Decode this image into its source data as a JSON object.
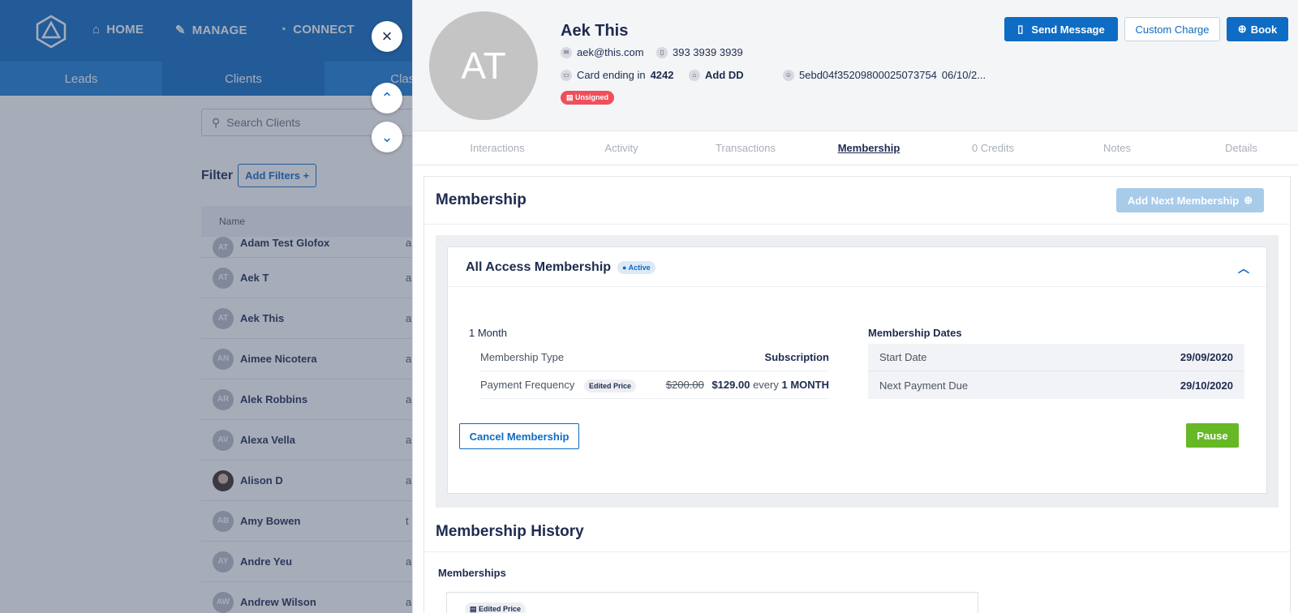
{
  "nav": {
    "home": "HOME",
    "manage": "MANAGE",
    "connect": "CONNECT",
    "subtabs": [
      "Leads",
      "Clients",
      "Class"
    ]
  },
  "client_list": {
    "search_placeholder": "Search Clients",
    "filter_label": "Filter",
    "add_filters": "Add Filters",
    "name_header": "Name",
    "rows": [
      {
        "initials": "AT",
        "name": "Adam Test Glofox",
        "trail": "a"
      },
      {
        "initials": "AT",
        "name": "Aek T",
        "trail": "a"
      },
      {
        "initials": "AT",
        "name": "Aek This",
        "trail": "a"
      },
      {
        "initials": "AN",
        "name": "Aimee Nicotera",
        "trail": "a"
      },
      {
        "initials": "AR",
        "name": "Alek Robbins",
        "trail": "a"
      },
      {
        "initials": "AV",
        "name": "Alexa Vella",
        "trail": "a"
      },
      {
        "initials": "",
        "name": "Alison D",
        "trail": "a"
      },
      {
        "initials": "AB",
        "name": "Amy Bowen",
        "trail": "t"
      },
      {
        "initials": "AY",
        "name": "Andre Yeu",
        "trail": "a"
      },
      {
        "initials": "AW",
        "name": "Andrew Wilson",
        "trail": "a"
      }
    ]
  },
  "profile": {
    "initials": "AT",
    "name": "Aek This",
    "email": "aek@this.com",
    "phone": "393 3939 3939",
    "card_prefix": "Card ending in",
    "card_last4": "4242",
    "add_dd": "Add DD",
    "client_id": "5ebd04f35209800025073754",
    "joined": "06/10/2...",
    "unsigned": "Unsigned",
    "send_message": "Send Message",
    "custom_charge": "Custom Charge",
    "book": "Book"
  },
  "tabs": [
    "Interactions",
    "Activity",
    "Transactions",
    "Membership",
    "0 Credits",
    "Notes",
    "Details"
  ],
  "membership": {
    "title": "Membership",
    "add_next": "Add Next Membership",
    "name": "All Access Membership",
    "status": "Active",
    "duration": "1 Month",
    "type_label": "Membership Type",
    "type_value": "Subscription",
    "freq_label": "Payment Frequency",
    "edited_price": "Edited Price",
    "old_price": "$200.00",
    "new_price": "$129.00",
    "every": "every",
    "period": "1 MONTH",
    "dates_title": "Membership Dates",
    "start_label": "Start Date",
    "start_value": "29/09/2020",
    "next_label": "Next Payment Due",
    "next_value": "29/10/2020",
    "cancel": "Cancel Membership",
    "pause": "Pause"
  },
  "history": {
    "title": "Membership History",
    "memberships_label": "Memberships",
    "edited_price": "Edited Price"
  }
}
